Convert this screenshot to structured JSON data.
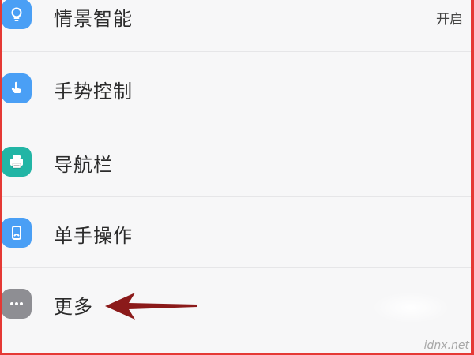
{
  "settings": {
    "items": [
      {
        "label": "情景智能",
        "value": "开启",
        "icon": "lightbulb-icon",
        "color": "#4a9ff5"
      },
      {
        "label": "手势控制",
        "icon": "gesture-hand-icon",
        "color": "#4a9ff5"
      },
      {
        "label": "导航栏",
        "icon": "navigation-bar-icon",
        "color": "#22b5a5"
      },
      {
        "label": "单手操作",
        "icon": "one-hand-mode-icon",
        "color": "#4a9ff5"
      },
      {
        "label": "更多",
        "icon": "more-dots-icon",
        "color": "#8e8e93"
      }
    ]
  },
  "annotation": {
    "arrow_color": "#8b1a1a",
    "border_color": "#e53935"
  },
  "watermark": {
    "text": "idnx.net"
  }
}
